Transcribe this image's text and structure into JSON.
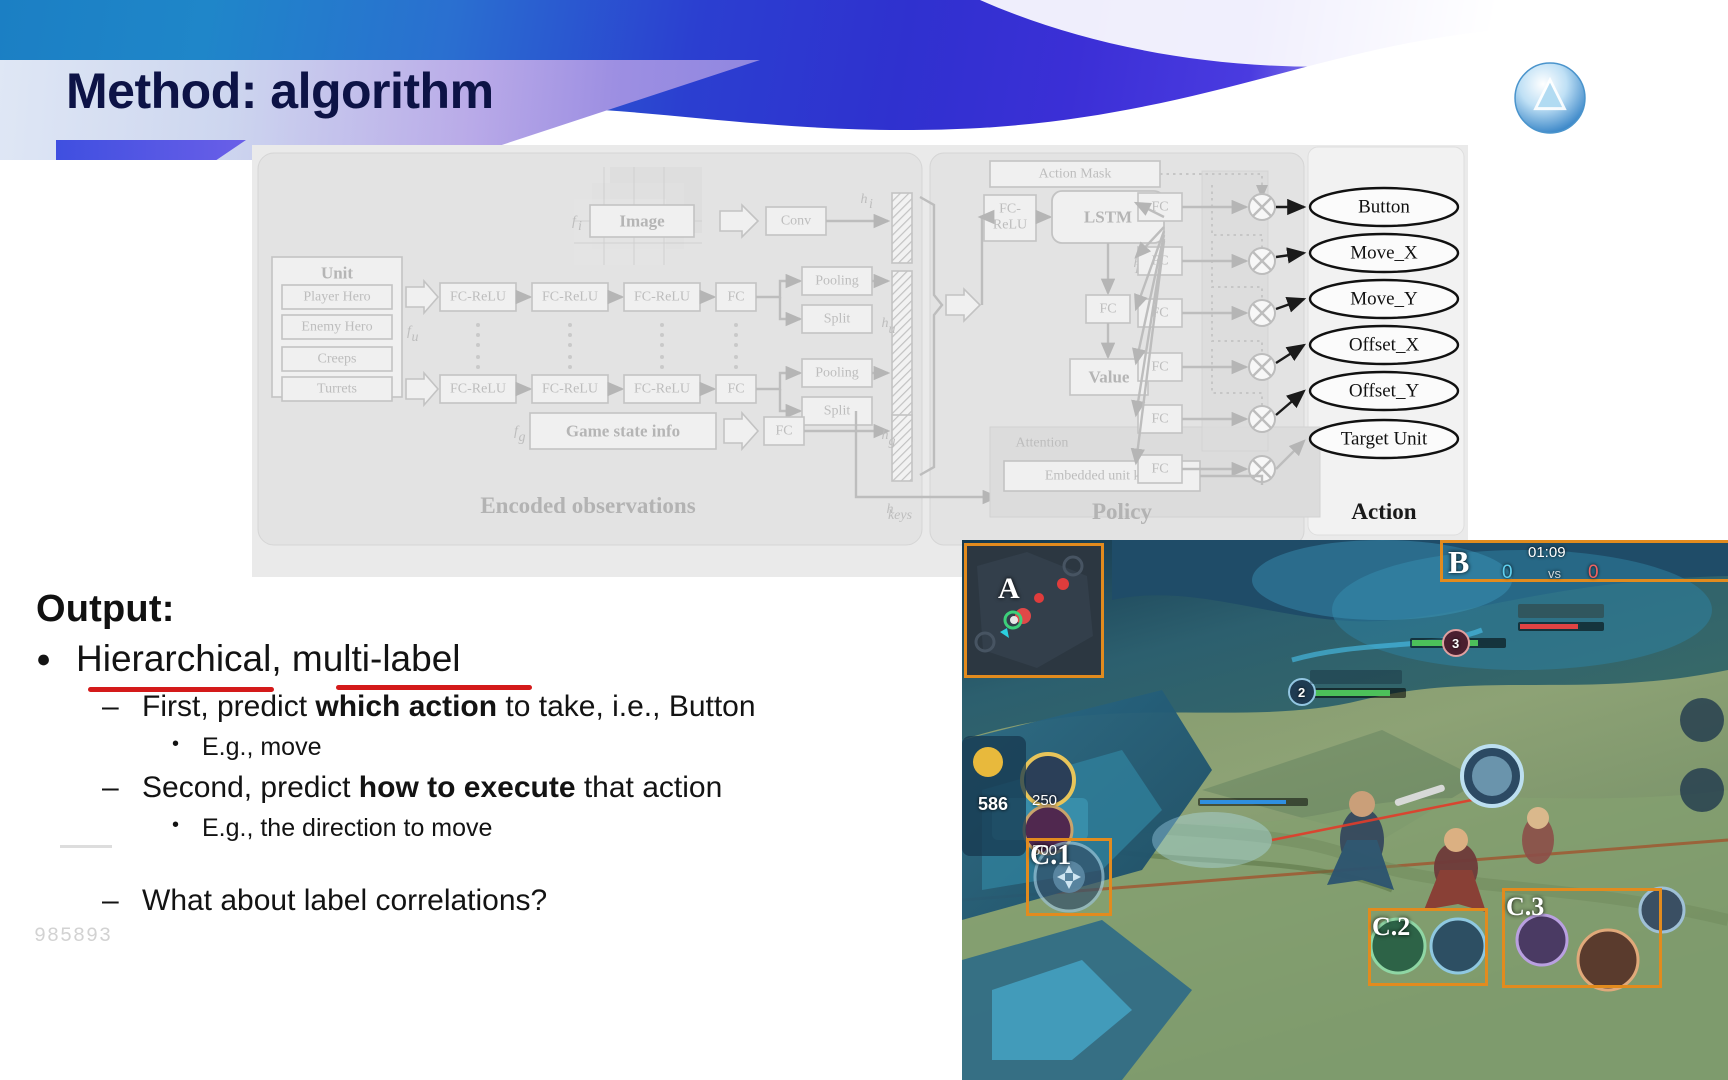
{
  "slide": {
    "title": "Method: algorithm",
    "logo_icon": "water-drop-logo-icon",
    "watermark": "985893"
  },
  "diagram": {
    "caption_encoded": "Encoded observations",
    "caption_policy": "Policy",
    "caption_action": "Action",
    "unit_group": {
      "title": "Unit",
      "items": [
        "Player Hero",
        "Enemy Hero",
        "Creeps",
        "Turrets"
      ]
    },
    "feature_labels": {
      "image": "f_i",
      "unit": "f_u",
      "game": "f_g"
    },
    "hidden_labels": {
      "image_h": "h_i",
      "unit_h": "h_u",
      "game_h": "h_g",
      "keys_h": "h_keys",
      "lstm_h": "h_LSTM"
    },
    "blocks": {
      "image": "Image",
      "conv": "Conv",
      "game_state": "Game state info",
      "fc": "FC",
      "fc_relu": "FC-ReLU",
      "fc_relu_stack": "FC-\nReLU",
      "pooling": "Pooling",
      "split": "Split",
      "lstm": "LSTM",
      "value": "Value",
      "action_mask": "Action Mask",
      "attention": "Attention",
      "embedded_unit_keys": "Embedded  unit keys"
    },
    "encoder_rows": [
      [
        "FC-ReLU",
        "FC-ReLU",
        "FC-ReLU",
        "FC"
      ],
      [
        "FC-ReLU",
        "FC-ReLU",
        "FC-ReLU",
        "FC"
      ]
    ],
    "actions": [
      "Button",
      "Move_X",
      "Move_Y",
      "Offset_X",
      "Offset_Y",
      "Target Unit"
    ],
    "colors": {
      "panel_bg": "#eaeaea",
      "faded_stroke": "#b9b9b9",
      "dark_stroke": "#111111"
    }
  },
  "output": {
    "heading": "Output:",
    "bullet1": {
      "marker": "●",
      "text": "Hierarchical, multi-label",
      "underline_words": [
        "Hierarchical",
        "multi-label"
      ],
      "underline_color": "#d41a1a"
    },
    "sub1": {
      "marker": "–",
      "pre": "First, predict ",
      "bold": "which action",
      "post": " to take, i.e., Button"
    },
    "sub1_example": {
      "marker": "•",
      "text": "E.g., move"
    },
    "sub2": {
      "marker": "–",
      "pre": "Second, predict ",
      "bold": "how to execute",
      "post": " that action"
    },
    "sub2_example": {
      "marker": "•",
      "text": "E.g., the direction to move"
    },
    "sub3": {
      "marker": "–",
      "text": "What about label correlations?"
    }
  },
  "game_screenshot": {
    "annotations": [
      {
        "id": "A",
        "label": "A",
        "meaning": "minimap"
      },
      {
        "id": "B",
        "label": "B",
        "meaning": "scoreboard"
      },
      {
        "id": "C1",
        "label": "C.1",
        "meaning": "move-joystick"
      },
      {
        "id": "C2",
        "label": "C.2",
        "meaning": "skill-buttons"
      },
      {
        "id": "C3",
        "label": "C.3",
        "meaning": "attack-buttons"
      }
    ],
    "hud": {
      "timer": "01:09",
      "score_blue": "0",
      "score_vs": "vs",
      "score_red": "0",
      "gold": "586",
      "item_cost_1": "250",
      "item_cost_2": "500",
      "level_badge_1": "3",
      "level_badge_2": "2"
    },
    "box_color": "#e28b1e"
  }
}
